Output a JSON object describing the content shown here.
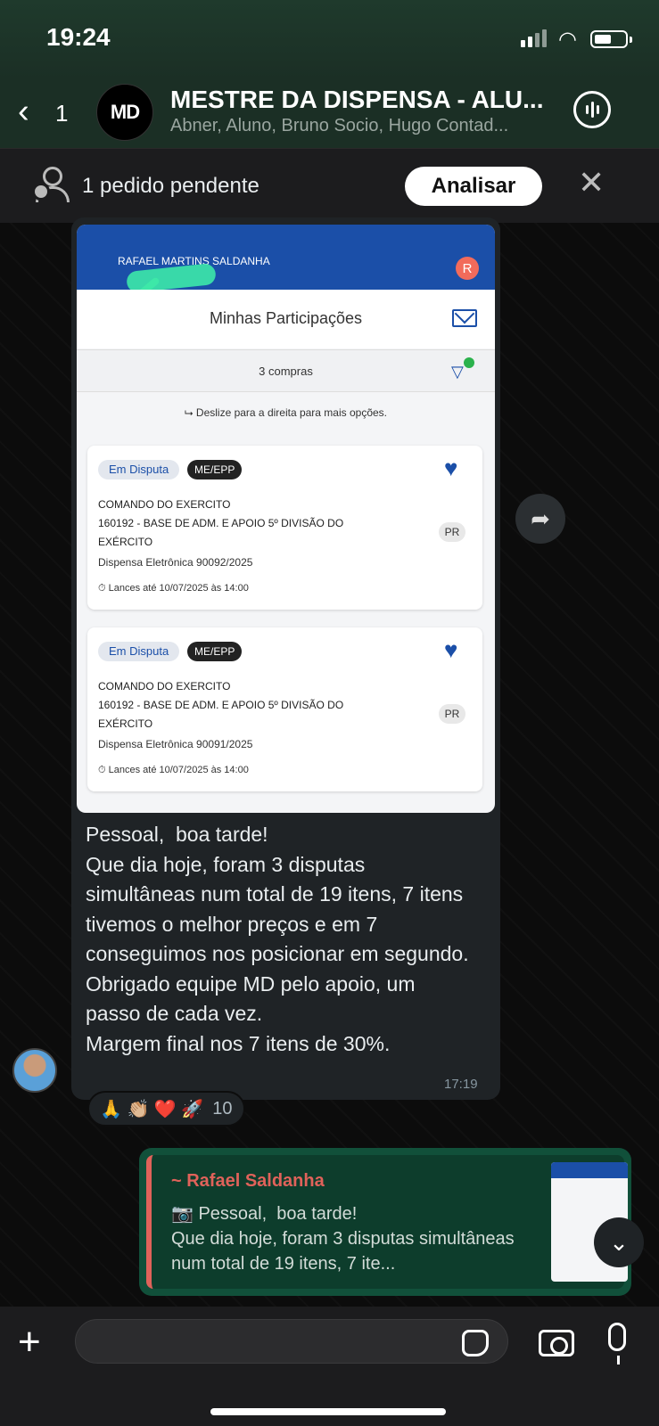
{
  "status": {
    "time": "19:24"
  },
  "header": {
    "back_count": "1",
    "avatar_text": "MD",
    "title": "MESTRE DA DISPENSA - ALU...",
    "subtitle": "Abner, Aluno, Bruno Socio, Hugo Contad..."
  },
  "pending": {
    "text": "1 pedido pendente",
    "button": "Analisar"
  },
  "message": {
    "screenshot": {
      "user_name": "RAFAEL MARTINS SALDANHA",
      "avatar_letter": "R",
      "title": "Minhas Participações",
      "count": "3 compras",
      "hint": "⮡ Deslize para a direita para mais opções.",
      "cards": [
        {
          "status": "Em Disputa",
          "tag": "ME/EPP",
          "org_line1": "COMANDO DO EXERCITO",
          "org_line2": "160192 - BASE DE ADM. E APOIO 5º DIVISÃO DO EXÉRCITO",
          "uf": "PR",
          "dispensa": "Dispensa Eletrônica 90092/2025",
          "lances": "Lances até 10/07/2025 às 14:00"
        },
        {
          "status": "Em Disputa",
          "tag": "ME/EPP",
          "org_line1": "COMANDO DO EXERCITO",
          "org_line2": "160192 - BASE DE ADM. E APOIO 5º DIVISÃO DO EXÉRCITO",
          "uf": "PR",
          "dispensa": "Dispensa Eletrônica 90091/2025",
          "lances": "Lances até 10/07/2025 às 14:00"
        }
      ]
    },
    "text": "Pessoal,  boa tarde!\nQue dia hoje, foram 3 disputas simultâneas num total de 19 itens, 7 itens tivemos o melhor preços e em 7 conseguimos nos posicionar em segundo.\nObrigado equipe MD pelo apoio, um passo de cada vez.\nMargem final nos 7 itens de 30%.",
    "time": "17:19",
    "reactions": {
      "emojis": "🙏 👏🏼 ❤️ 🚀",
      "count": "10"
    }
  },
  "reply": {
    "author": "~ Rafael Saldanha",
    "text": "Pessoal,  boa tarde!\nQue dia hoje, foram 3 disputas simultâneas num total de 19 itens, 7 ite..."
  },
  "composer": {
    "placeholder": ""
  },
  "colors": {
    "header_bg": "#1b2f25",
    "bubble_bg": "#1f2326",
    "reply_bg": "#11503a",
    "accent": "#e0625a",
    "app_blue": "#1b4fa8"
  }
}
